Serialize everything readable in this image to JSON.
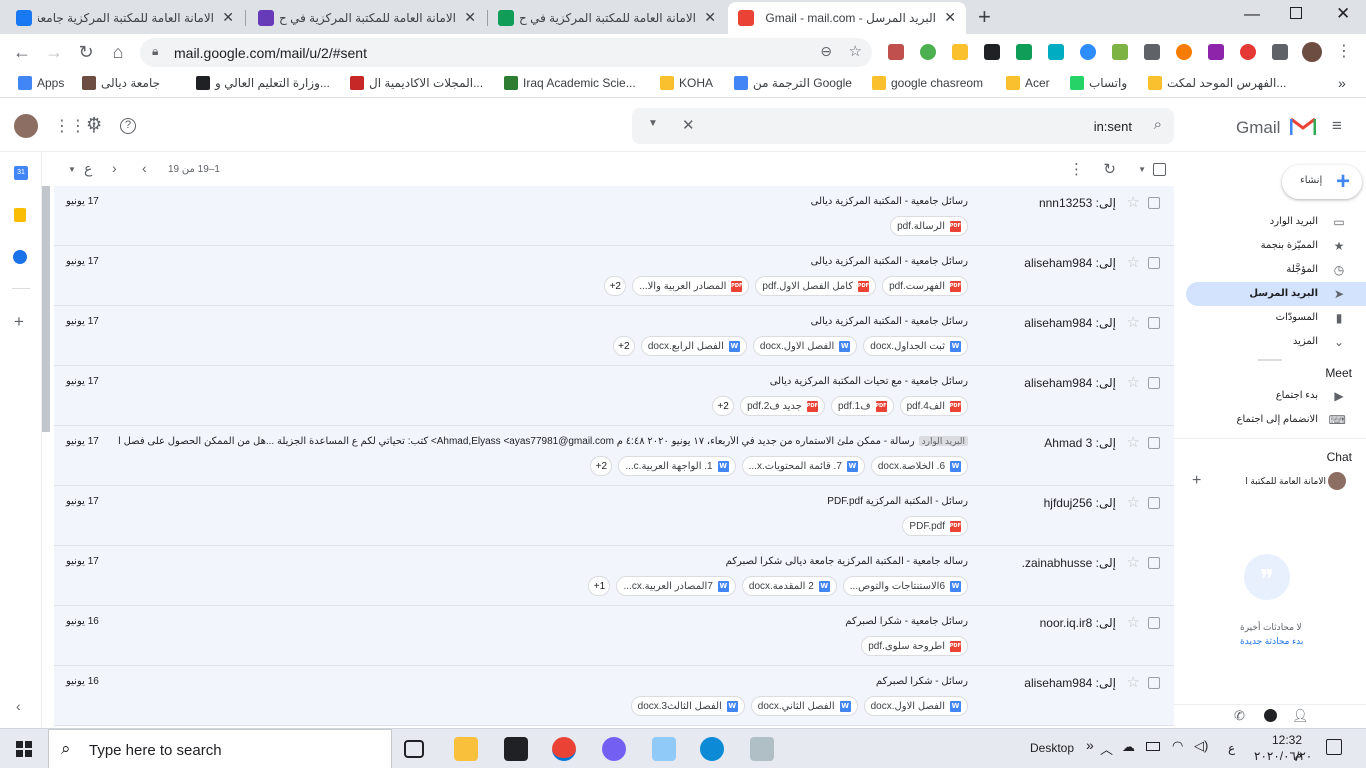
{
  "browser": {
    "tabs": [
      {
        "title": "الامانة العامة للمكتبة المركزية جامعة",
        "icon_color": "#1877f2",
        "active": false
      },
      {
        "title": "الامانة العامة للمكتبة المركزية في ح",
        "icon_color": "#673ab7",
        "active": false
      },
      {
        "title": "الامانة العامة للمكتبة المركزية في ح",
        "icon_color": "#0f9d58",
        "active": false
      },
      {
        "title": "البريد المرسل - Gmail - mail.com",
        "icon_color": "#ea4335",
        "active": true
      }
    ],
    "new_tab_label": "+",
    "url": "mail.google.com/mail/u/2/#sent",
    "bookmarks": [
      {
        "label": "Apps",
        "color": "#4285f4"
      },
      {
        "label": "جامعة ديالى",
        "color": "#6d4c41"
      },
      {
        "label": "وزارة التعليم العالي و...",
        "color": "#202124"
      },
      {
        "label": "المجلات الاكاديمية ال...",
        "color": "#c62828"
      },
      {
        "label": "Iraq Academic Scie...",
        "color": "#2e7d32"
      },
      {
        "label": "KOHA",
        "color": "#fbc02d"
      },
      {
        "label": "الترجمة من Google",
        "color": "#4285f4"
      },
      {
        "label": "google chasreom",
        "color": "#fbc02d"
      },
      {
        "label": "Acer",
        "color": "#fbc02d"
      },
      {
        "label": "واتساب",
        "color": "#25d366"
      },
      {
        "label": "الفهرس الموحد لمكت...",
        "color": "#fbc02d"
      }
    ]
  },
  "gmail": {
    "logo_text": "Gmail",
    "search_query": "in:sent",
    "compose_label": "إنشاء",
    "pagination": "1–19 من 19",
    "lang_key": "ع",
    "nav": [
      {
        "label": "البريد الوارد",
        "icon": "inbox-icon",
        "glyph": "▭",
        "selected": false
      },
      {
        "label": "المميّزة بنجمة",
        "icon": "star-icon",
        "glyph": "★",
        "selected": false
      },
      {
        "label": "المؤجَّلة",
        "icon": "clock-icon",
        "glyph": "◷",
        "selected": false
      },
      {
        "label": "البريد المرسل",
        "icon": "send-icon",
        "glyph": "➤",
        "selected": true
      },
      {
        "label": "المسودّات",
        "icon": "draft-icon",
        "glyph": "▮",
        "selected": false
      },
      {
        "label": "المزيد",
        "icon": "chevron-down-icon",
        "glyph": "⌄",
        "selected": false
      }
    ],
    "meet": {
      "title": "Meet",
      "items": [
        {
          "label": "بدء اجتماع",
          "icon": "video-icon",
          "glyph": "▶"
        },
        {
          "label": "الانضمام إلى اجتماع",
          "icon": "keyboard-icon",
          "glyph": "⌨"
        }
      ]
    },
    "chat": {
      "title": "Chat",
      "contact": "الامانة العامة للمكتبة ا",
      "empty_line1": "لا محادثات أخيرة",
      "empty_line2": "بدء محادثة جديدة"
    },
    "emails": [
      {
        "to": "إلى: nnn13253",
        "subject": "رسائل جامعية - المكتبة المركزية ديالى",
        "label": "",
        "date": "17 يونيو",
        "attachments": [
          {
            "name": "الرسالة.pdf",
            "type": "pdf"
          }
        ],
        "more": ""
      },
      {
        "to": "إلى: aliseham984",
        "subject": "رسائل جامعية - المكتبة المركزية ديالى",
        "label": "",
        "date": "17 يونيو",
        "attachments": [
          {
            "name": "الفهرست.pdf",
            "type": "pdf"
          },
          {
            "name": "كامل الفصل الاول.pdf",
            "type": "pdf"
          },
          {
            "name": "المصادر العربية والا...",
            "type": "pdf"
          }
        ],
        "more": "+2"
      },
      {
        "to": "إلى: aliseham984",
        "subject": "رسائل جامعية - المكتبة المركزية ديالى",
        "label": "",
        "date": "17 يونيو",
        "attachments": [
          {
            "name": "ثبت الجداول.docx",
            "type": "word"
          },
          {
            "name": "الفصل الاول.docx",
            "type": "word"
          },
          {
            "name": "الفصل الرابع.docx",
            "type": "word"
          }
        ],
        "more": "+2"
      },
      {
        "to": "إلى: aliseham984",
        "subject": "رسائل جامعية - مع تحيات المكتبة المركزية ديالى",
        "label": "",
        "date": "17 يونيو",
        "attachments": [
          {
            "name": "الف4.pdf",
            "type": "pdf"
          },
          {
            "name": "ف1.pdf",
            "type": "pdf"
          },
          {
            "name": "جديد ف2.pdf",
            "type": "pdf"
          }
        ],
        "more": "+2"
      },
      {
        "to": "إلى: Ahmad 3",
        "subject": "رسالة - ممكن ملئ الاستماره من جديد في الأربعاء، ١٧ يونيو ٢٠٢٠ ٤:٤٨ م Ahmad,Elyass <ayas77981@gmail.com> كتب: تحياتي لكم ع المساعدة الجزيلة ...هل من الممكن الحصول على فصل العملي والنتائج ...",
        "label": "البريد الوارد",
        "date": "17 يونيو",
        "attachments": [
          {
            "name": "6. الخلاصة.docx",
            "type": "word"
          },
          {
            "name": "7. قائمة المحتويات.x...",
            "type": "word"
          },
          {
            "name": "1. الواجهة العربية.c...",
            "type": "word"
          }
        ],
        "more": "+2"
      },
      {
        "to": "إلى: hjfduj256",
        "subject": "رسائل - المكتبة المركزية PDF.pdf",
        "label": "",
        "date": "17 يونيو",
        "attachments": [
          {
            "name": "PDF.pdf",
            "type": "pdf"
          }
        ],
        "more": ""
      },
      {
        "to": "إلى: zainabhusse.",
        "subject": "رساله جامعية - المكتبة المركزية جامعة ديالى شكرا لصبركم",
        "label": "",
        "date": "17 يونيو",
        "attachments": [
          {
            "name": "6الاستنتاجات والتوص...",
            "type": "word"
          },
          {
            "name": "2 المقدمة.docx",
            "type": "word"
          },
          {
            "name": "7المصادر العربية.cx...",
            "type": "word"
          }
        ],
        "more": "+1"
      },
      {
        "to": "إلى: noor.iq.ir8",
        "subject": "رسائل جامعية - شكرا لصبركم",
        "label": "",
        "date": "16 يونيو",
        "attachments": [
          {
            "name": "اطروحة سلوى.pdf",
            "type": "pdf"
          }
        ],
        "more": ""
      },
      {
        "to": "إلى: aliseham984",
        "subject": "رسائل - شكرا لصبركم",
        "label": "",
        "date": "16 يونيو",
        "attachments": [
          {
            "name": "الفصل الاول.docx",
            "type": "word"
          },
          {
            "name": "الفصل الثاني.docx",
            "type": "word"
          },
          {
            "name": "الفصل الثالث3.docx",
            "type": "word"
          }
        ],
        "more": ""
      }
    ]
  },
  "taskbar": {
    "search_placeholder": "Type here to search",
    "desktop_label": "Desktop",
    "lang": "ع",
    "time": "12:32 م",
    "date": "٢٠٢٠/٠٦/٢٠"
  }
}
